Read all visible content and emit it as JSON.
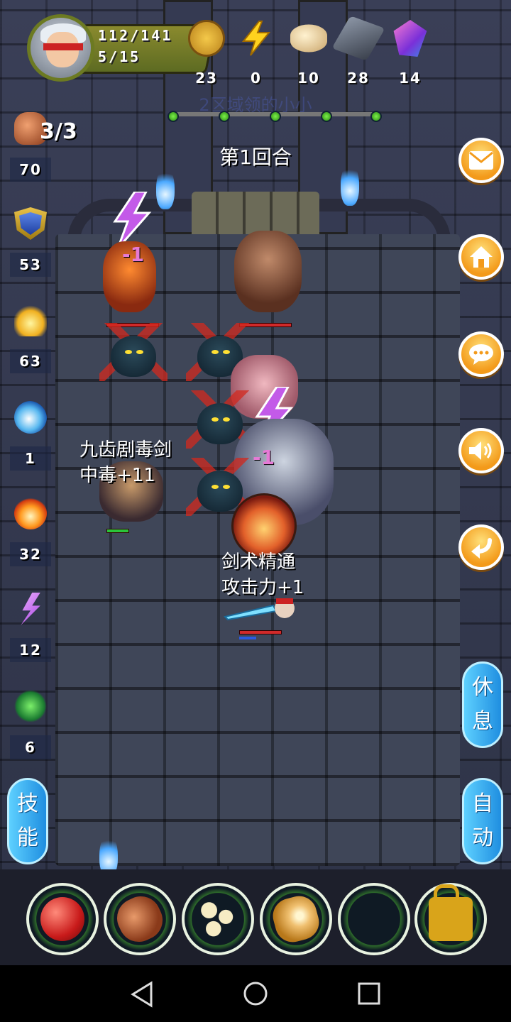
{
  "hero": {
    "hp": "112/141",
    "level": "5/15"
  },
  "resources": [
    {
      "icon": "gold-coin-icon",
      "value": "23"
    },
    {
      "icon": "energy-bolt-icon",
      "value": "0"
    },
    {
      "icon": "dough-icon",
      "value": "10"
    },
    {
      "icon": "iron-ore-icon",
      "value": "28"
    },
    {
      "icon": "crystal-gem-icon",
      "value": "14"
    }
  ],
  "stage_title": "2区域领的小小",
  "progress_nodes": 5,
  "round_label": "第1回合",
  "left_stats": [
    {
      "icon": "fist-icon",
      "value": "70"
    },
    {
      "icon": "shield-icon",
      "value": "53"
    },
    {
      "icon": "flame-up-icon",
      "value": "63"
    },
    {
      "icon": "water-wave-icon",
      "value": "1"
    },
    {
      "icon": "fire-icon",
      "value": "32"
    },
    {
      "icon": "lightning-icon",
      "value": "12"
    },
    {
      "icon": "poison-icon",
      "value": "6"
    }
  ],
  "attack_count": "3/3",
  "right_buttons": [
    "mail-icon",
    "home-icon",
    "chat-icon",
    "sound-icon",
    "back-icon"
  ],
  "rest_button": [
    "休",
    "息"
  ],
  "skill_button": [
    "技",
    "能"
  ],
  "auto_button": [
    "自",
    "动"
  ],
  "field": {
    "damage_1": "-1",
    "damage_2": "-1",
    "combat_text_1": [
      "九齿剧毒剑",
      "中毒+11"
    ],
    "combat_text_2": [
      "剑术精通",
      "攻击力+1"
    ]
  },
  "items": [
    "apple-icon",
    "meat-icon",
    "beans-icon",
    "bread-icon",
    "empty-slot",
    "lock-icon"
  ],
  "colors": {
    "accent_orange": "#f39a1a",
    "pill_blue": "#1f8ee0",
    "hp_red": "#d12a2a",
    "progress_green": "#5cd42a"
  }
}
